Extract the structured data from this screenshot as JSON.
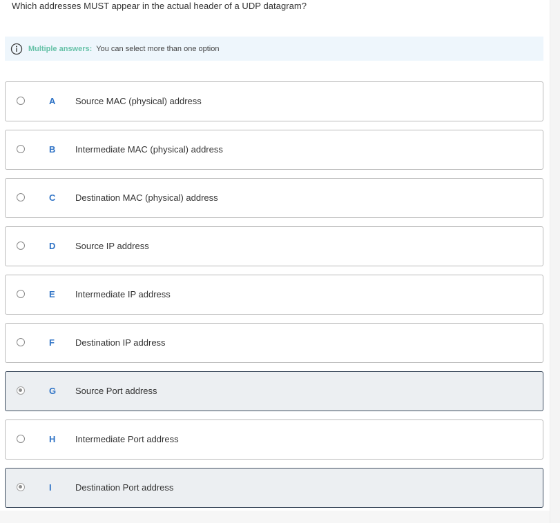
{
  "question": {
    "text": "Which addresses MUST appear in the actual header of a UDP datagram?"
  },
  "info": {
    "icon": "info-icon",
    "title": "Multiple answers:",
    "text": "You can select more than one option",
    "title_color": "#67c2a8",
    "background": "#eef6fc"
  },
  "options": [
    {
      "letter": "A",
      "text": "Source MAC (physical) address",
      "selected": false
    },
    {
      "letter": "B",
      "text": "Intermediate MAC (physical) address",
      "selected": false
    },
    {
      "letter": "C",
      "text": "Destination MAC (physical) address",
      "selected": false
    },
    {
      "letter": "D",
      "text": "Source IP address",
      "selected": false
    },
    {
      "letter": "E",
      "text": "Intermediate IP address",
      "selected": false
    },
    {
      "letter": "F",
      "text": "Destination IP address",
      "selected": false
    },
    {
      "letter": "G",
      "text": "Source Port address",
      "selected": true
    },
    {
      "letter": "H",
      "text": "Intermediate Port address",
      "selected": false
    },
    {
      "letter": "I",
      "text": "Destination Port address",
      "selected": true
    }
  ],
  "colors": {
    "letter": "#2f73c6",
    "selected_background": "#eceff2",
    "selected_border": "#3b4a5c"
  }
}
